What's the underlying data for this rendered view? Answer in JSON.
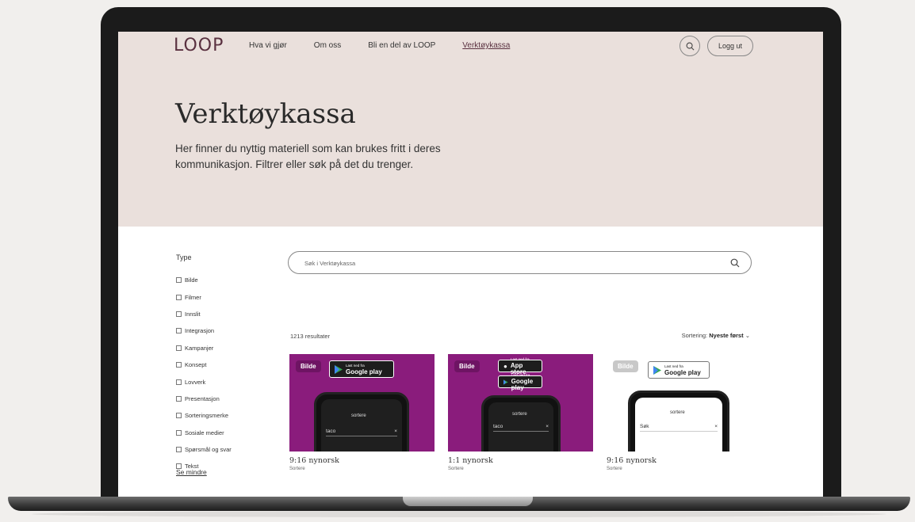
{
  "header": {
    "logo": "LOOP",
    "nav": [
      "Hva vi gjør",
      "Om oss",
      "Bli en del av LOOP",
      "Verktøykassa"
    ],
    "active_nav": "Verktøykassa",
    "logout_label": "Logg ut"
  },
  "hero": {
    "title": "Verktøykassa",
    "description": "Her finner du nyttig materiell som kan brukes fritt i deres kommunikasjon. Filtrer eller søk på det du trenger."
  },
  "filters": {
    "heading": "Type",
    "items": [
      "Bilde",
      "Filmer",
      "Innslit",
      "Integrasjon",
      "Kampanjer",
      "Konsept",
      "Lovverk",
      "Presentasjon",
      "Sorteringsmerke",
      "Sosiale medier",
      "Spørsmål og svar",
      "Tekst"
    ],
    "see_less": "Se mindre"
  },
  "search": {
    "placeholder": "Søk i Verktøykassa"
  },
  "results": {
    "count": "1213 resultater",
    "sort_label": "Sortering:",
    "sort_value": "Nyeste først"
  },
  "cards": [
    {
      "badge": "Bilde",
      "store_top": "Last ned fra",
      "store_name": "Google play",
      "app_header": "sortere",
      "app_search": "taco",
      "title": "9:16 nynorsk",
      "subtitle": "Sortere"
    },
    {
      "badge": "Bilde",
      "store_top": "Last ned fra",
      "store_name": "App store",
      "store2_name": "Google play",
      "app_header": "sortere",
      "app_search": "taco",
      "title": "1:1 nynorsk",
      "subtitle": "Sortere"
    },
    {
      "badge": "Bilde",
      "store_top": "Last ned fra",
      "store_name": "Google play",
      "app_header": "sortere",
      "app_search": "Søk",
      "title": "9:16 nynorsk",
      "subtitle": "Sortere"
    }
  ],
  "colors": {
    "hero_bg": "#eae0dc",
    "brand": "#5a3140",
    "card_purple": "#8a1c7c"
  }
}
